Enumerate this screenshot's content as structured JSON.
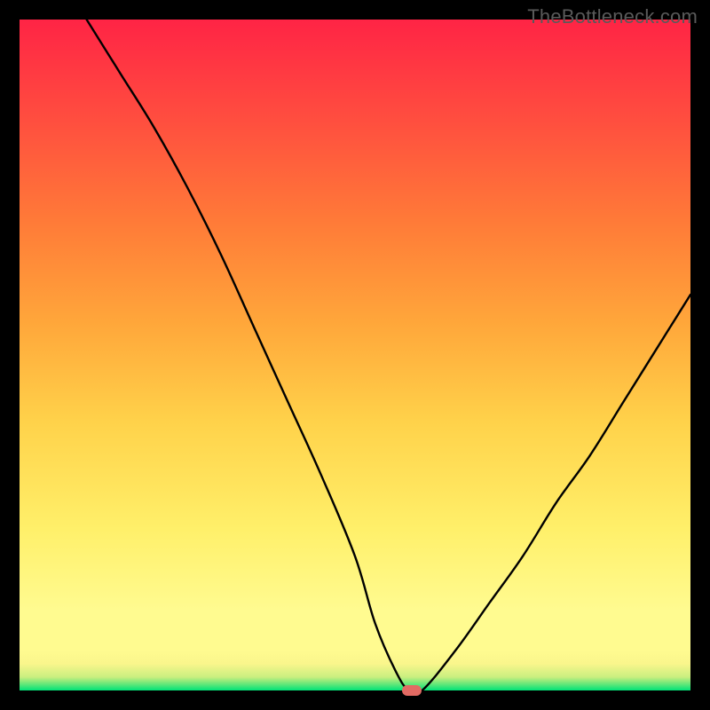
{
  "watermark": "TheBottleneck.com",
  "chart_data": {
    "type": "line",
    "title": "",
    "xlabel": "",
    "ylabel": "",
    "xlim": [
      0,
      100
    ],
    "ylim": [
      0,
      100
    ],
    "grid": false,
    "legend": false,
    "series": [
      {
        "name": "bottleneck-curve",
        "x": [
          10,
          15,
          20,
          25,
          30,
          35,
          40,
          45,
          50,
          53,
          56,
          58,
          60,
          65,
          70,
          75,
          80,
          85,
          90,
          95,
          100
        ],
        "y": [
          100,
          92,
          84,
          75,
          65,
          54,
          43,
          32,
          20,
          10,
          3,
          0,
          0,
          6,
          13,
          20,
          28,
          35,
          43,
          51,
          59
        ]
      }
    ],
    "flat_segment": {
      "x_start": 53,
      "x_end": 60,
      "y": 0
    },
    "min_marker": {
      "x": 58.5,
      "y": 0,
      "color": "#e26a63"
    },
    "background_gradient": {
      "stops": [
        {
          "pos": 0.0,
          "color": "#00e278"
        },
        {
          "pos": 0.02,
          "color": "#c9ef80"
        },
        {
          "pos": 0.06,
          "color": "#fffb90"
        },
        {
          "pos": 0.24,
          "color": "#fff06a"
        },
        {
          "pos": 0.4,
          "color": "#ffd24a"
        },
        {
          "pos": 0.55,
          "color": "#ffa63a"
        },
        {
          "pos": 0.7,
          "color": "#ff7a38"
        },
        {
          "pos": 0.85,
          "color": "#ff4e3f"
        },
        {
          "pos": 1.0,
          "color": "#ff2445"
        }
      ],
      "direction": "bottom-to-top"
    }
  }
}
